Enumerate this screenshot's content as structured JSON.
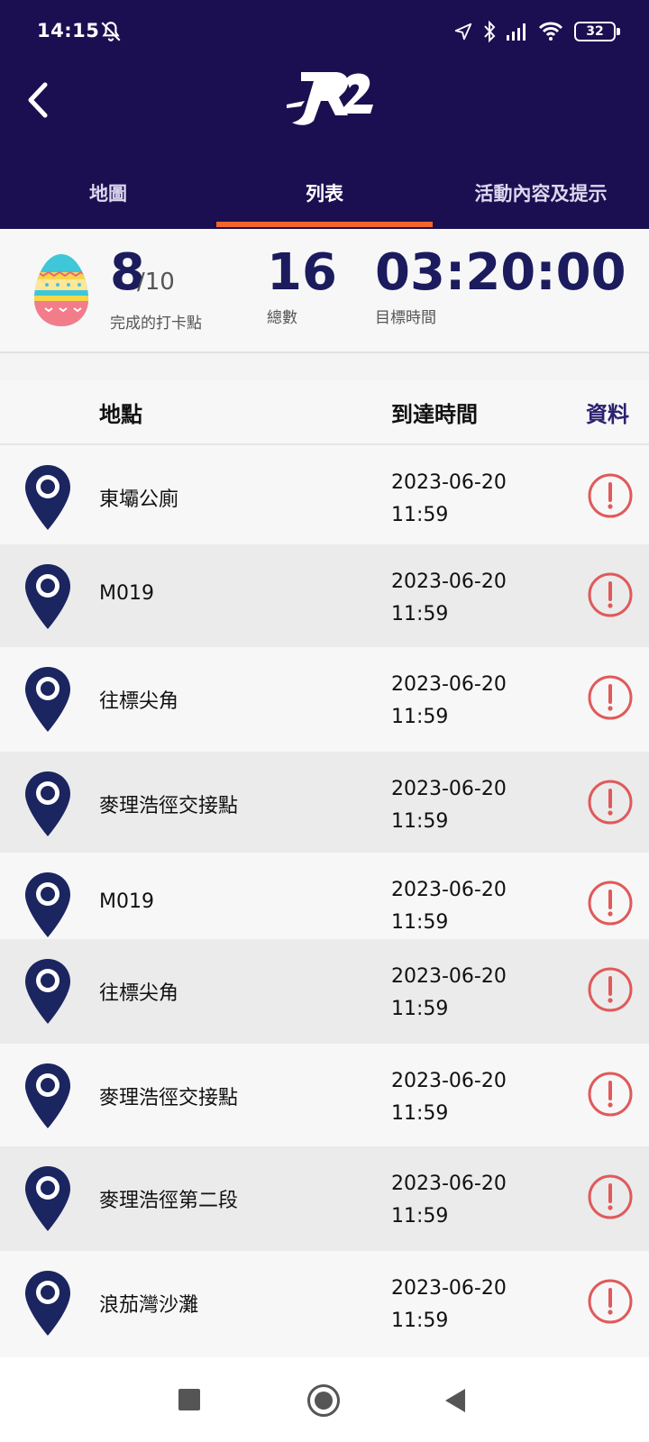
{
  "status_bar": {
    "time": "14:15",
    "battery": "32"
  },
  "header": {
    "logo": "R2"
  },
  "tabs": [
    {
      "label": "地圖"
    },
    {
      "label": "列表"
    },
    {
      "label": "活動內容及提示"
    }
  ],
  "active_tab_index": 1,
  "colors": {
    "header_bg": "#1b0f51",
    "accent": "#f2642d",
    "pin": "#1b2560",
    "alert": "#e05a5a"
  },
  "stats": {
    "completed": "8",
    "completed_total": "/10",
    "completed_label": "完成的打卡點",
    "total": "16",
    "total_label": "總數",
    "target_time": "03:20:00",
    "target_label": "目標時間"
  },
  "list_header": {
    "location": "地點",
    "arrival": "到達時間",
    "info": "資料"
  },
  "rows": [
    {
      "name": "東壩公廁",
      "date": "2023-06-20",
      "time": "11:59"
    },
    {
      "name": "M019",
      "date": "2023-06-20",
      "time": "11:59"
    },
    {
      "name": "往標尖角",
      "date": "2023-06-20",
      "time": "11:59"
    },
    {
      "name": "麥理浩徑交接點",
      "date": "2023-06-20",
      "time": "11:59"
    },
    {
      "name": "M019",
      "date": "2023-06-20",
      "time": "11:59"
    },
    {
      "name": "往標尖角",
      "date": "2023-06-20",
      "time": "11:59"
    },
    {
      "name": "麥理浩徑交接點",
      "date": "2023-06-20",
      "time": "11:59"
    },
    {
      "name": "麥理浩徑第二段",
      "date": "2023-06-20",
      "time": "11:59"
    },
    {
      "name": "浪茄灣沙灘",
      "date": "2023-06-20",
      "time": "11:59"
    }
  ],
  "icons": {
    "pin": "location-pin-icon",
    "info": "alert-circle-icon",
    "back": "chevron-left-icon"
  }
}
